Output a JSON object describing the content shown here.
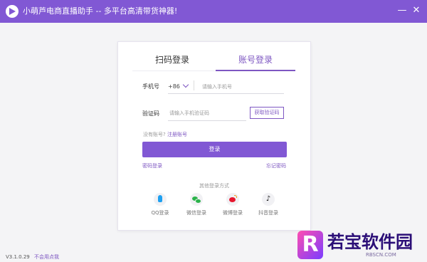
{
  "titlebar": {
    "title": "小萌芦电商直播助手 -- 多平台高清带货神器!",
    "minimize_label": "—",
    "close_label": "✕"
  },
  "tabs": [
    {
      "label": "扫码登录",
      "active": false
    },
    {
      "label": "账号登录",
      "active": true
    }
  ],
  "phone": {
    "label": "手机号",
    "country_code": "+86",
    "placeholder": "请输入手机号"
  },
  "code": {
    "label": "验证码",
    "placeholder": "请输入手机验证码",
    "get_code_label": "获取验证码"
  },
  "register": {
    "prompt": "没有账号?",
    "link_label": "注册账号"
  },
  "login_button": "登录",
  "links": {
    "password_login": "密码登录",
    "forgot_password": "忘记密码"
  },
  "other_login": {
    "title": "其他登录方式",
    "items": [
      {
        "label": "QQ登录",
        "icon": "qq-icon"
      },
      {
        "label": "微信登录",
        "icon": "wechat-icon"
      },
      {
        "label": "微博登录",
        "icon": "weibo-icon"
      },
      {
        "label": "抖音登录",
        "icon": "douyin-icon"
      }
    ]
  },
  "footer": {
    "version": "V3.1.0.29",
    "contact": "不会用点我"
  },
  "watermark": {
    "logo_letter": "R",
    "text": "若宝软件园",
    "sub": "RBSCN.COM"
  },
  "colors": {
    "accent": "#8158d4",
    "tab_active": "#7e57c2"
  }
}
